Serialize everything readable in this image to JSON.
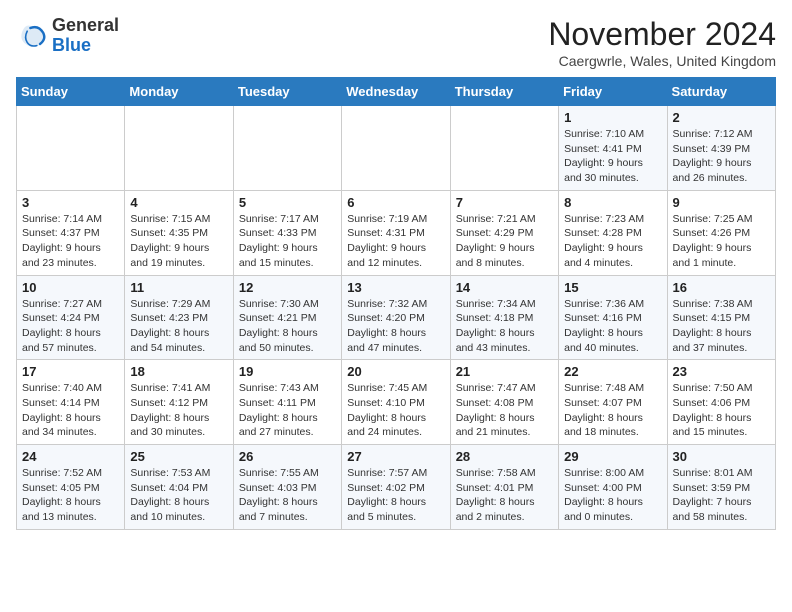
{
  "header": {
    "logo_general": "General",
    "logo_blue": "Blue",
    "month_title": "November 2024",
    "location": "Caergwrle, Wales, United Kingdom"
  },
  "weekdays": [
    "Sunday",
    "Monday",
    "Tuesday",
    "Wednesday",
    "Thursday",
    "Friday",
    "Saturday"
  ],
  "weeks": [
    [
      {
        "day": "",
        "info": ""
      },
      {
        "day": "",
        "info": ""
      },
      {
        "day": "",
        "info": ""
      },
      {
        "day": "",
        "info": ""
      },
      {
        "day": "",
        "info": ""
      },
      {
        "day": "1",
        "info": "Sunrise: 7:10 AM\nSunset: 4:41 PM\nDaylight: 9 hours\nand 30 minutes."
      },
      {
        "day": "2",
        "info": "Sunrise: 7:12 AM\nSunset: 4:39 PM\nDaylight: 9 hours\nand 26 minutes."
      }
    ],
    [
      {
        "day": "3",
        "info": "Sunrise: 7:14 AM\nSunset: 4:37 PM\nDaylight: 9 hours\nand 23 minutes."
      },
      {
        "day": "4",
        "info": "Sunrise: 7:15 AM\nSunset: 4:35 PM\nDaylight: 9 hours\nand 19 minutes."
      },
      {
        "day": "5",
        "info": "Sunrise: 7:17 AM\nSunset: 4:33 PM\nDaylight: 9 hours\nand 15 minutes."
      },
      {
        "day": "6",
        "info": "Sunrise: 7:19 AM\nSunset: 4:31 PM\nDaylight: 9 hours\nand 12 minutes."
      },
      {
        "day": "7",
        "info": "Sunrise: 7:21 AM\nSunset: 4:29 PM\nDaylight: 9 hours\nand 8 minutes."
      },
      {
        "day": "8",
        "info": "Sunrise: 7:23 AM\nSunset: 4:28 PM\nDaylight: 9 hours\nand 4 minutes."
      },
      {
        "day": "9",
        "info": "Sunrise: 7:25 AM\nSunset: 4:26 PM\nDaylight: 9 hours\nand 1 minute."
      }
    ],
    [
      {
        "day": "10",
        "info": "Sunrise: 7:27 AM\nSunset: 4:24 PM\nDaylight: 8 hours\nand 57 minutes."
      },
      {
        "day": "11",
        "info": "Sunrise: 7:29 AM\nSunset: 4:23 PM\nDaylight: 8 hours\nand 54 minutes."
      },
      {
        "day": "12",
        "info": "Sunrise: 7:30 AM\nSunset: 4:21 PM\nDaylight: 8 hours\nand 50 minutes."
      },
      {
        "day": "13",
        "info": "Sunrise: 7:32 AM\nSunset: 4:20 PM\nDaylight: 8 hours\nand 47 minutes."
      },
      {
        "day": "14",
        "info": "Sunrise: 7:34 AM\nSunset: 4:18 PM\nDaylight: 8 hours\nand 43 minutes."
      },
      {
        "day": "15",
        "info": "Sunrise: 7:36 AM\nSunset: 4:16 PM\nDaylight: 8 hours\nand 40 minutes."
      },
      {
        "day": "16",
        "info": "Sunrise: 7:38 AM\nSunset: 4:15 PM\nDaylight: 8 hours\nand 37 minutes."
      }
    ],
    [
      {
        "day": "17",
        "info": "Sunrise: 7:40 AM\nSunset: 4:14 PM\nDaylight: 8 hours\nand 34 minutes."
      },
      {
        "day": "18",
        "info": "Sunrise: 7:41 AM\nSunset: 4:12 PM\nDaylight: 8 hours\nand 30 minutes."
      },
      {
        "day": "19",
        "info": "Sunrise: 7:43 AM\nSunset: 4:11 PM\nDaylight: 8 hours\nand 27 minutes."
      },
      {
        "day": "20",
        "info": "Sunrise: 7:45 AM\nSunset: 4:10 PM\nDaylight: 8 hours\nand 24 minutes."
      },
      {
        "day": "21",
        "info": "Sunrise: 7:47 AM\nSunset: 4:08 PM\nDaylight: 8 hours\nand 21 minutes."
      },
      {
        "day": "22",
        "info": "Sunrise: 7:48 AM\nSunset: 4:07 PM\nDaylight: 8 hours\nand 18 minutes."
      },
      {
        "day": "23",
        "info": "Sunrise: 7:50 AM\nSunset: 4:06 PM\nDaylight: 8 hours\nand 15 minutes."
      }
    ],
    [
      {
        "day": "24",
        "info": "Sunrise: 7:52 AM\nSunset: 4:05 PM\nDaylight: 8 hours\nand 13 minutes."
      },
      {
        "day": "25",
        "info": "Sunrise: 7:53 AM\nSunset: 4:04 PM\nDaylight: 8 hours\nand 10 minutes."
      },
      {
        "day": "26",
        "info": "Sunrise: 7:55 AM\nSunset: 4:03 PM\nDaylight: 8 hours\nand 7 minutes."
      },
      {
        "day": "27",
        "info": "Sunrise: 7:57 AM\nSunset: 4:02 PM\nDaylight: 8 hours\nand 5 minutes."
      },
      {
        "day": "28",
        "info": "Sunrise: 7:58 AM\nSunset: 4:01 PM\nDaylight: 8 hours\nand 2 minutes."
      },
      {
        "day": "29",
        "info": "Sunrise: 8:00 AM\nSunset: 4:00 PM\nDaylight: 8 hours\nand 0 minutes."
      },
      {
        "day": "30",
        "info": "Sunrise: 8:01 AM\nSunset: 3:59 PM\nDaylight: 7 hours\nand 58 minutes."
      }
    ]
  ]
}
